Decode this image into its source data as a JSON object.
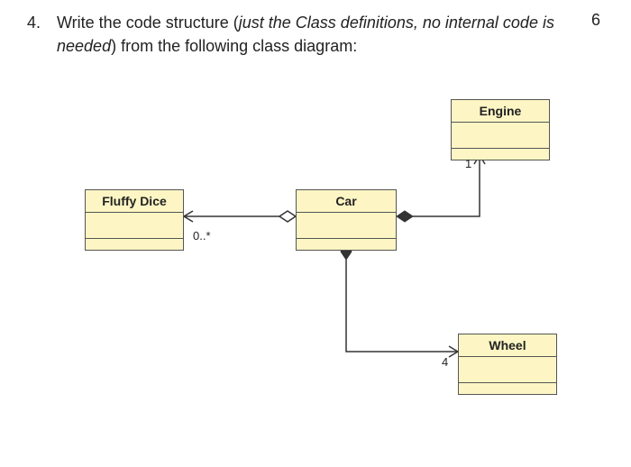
{
  "question": {
    "number": "4.",
    "prefix": "Write the code structure (",
    "italic": "just the Class definitions, no internal code is needed",
    "suffix": ") from the following class diagram:",
    "score": "6"
  },
  "classes": {
    "fluffy_dice": {
      "name": "Fluffy Dice"
    },
    "car": {
      "name": "Car"
    },
    "engine": {
      "name": "Engine"
    },
    "wheel": {
      "name": "Wheel"
    }
  },
  "multiplicities": {
    "fluffy_dice_side": "0..*",
    "engine_side": "1",
    "wheel_side": "4"
  },
  "chart_data": {
    "type": "uml_class_diagram",
    "classes": [
      "Fluffy Dice",
      "Car",
      "Engine",
      "Wheel"
    ],
    "relationships": [
      {
        "from": "Car",
        "to": "Fluffy Dice",
        "kind": "aggregation",
        "diamond_at": "Car",
        "multiplicity_to": "0..*"
      },
      {
        "from": "Car",
        "to": "Engine",
        "kind": "composition",
        "diamond_at": "Car",
        "multiplicity_to": "1"
      },
      {
        "from": "Car",
        "to": "Wheel",
        "kind": "composition",
        "diamond_at": "Car",
        "multiplicity_to": "4"
      }
    ]
  }
}
